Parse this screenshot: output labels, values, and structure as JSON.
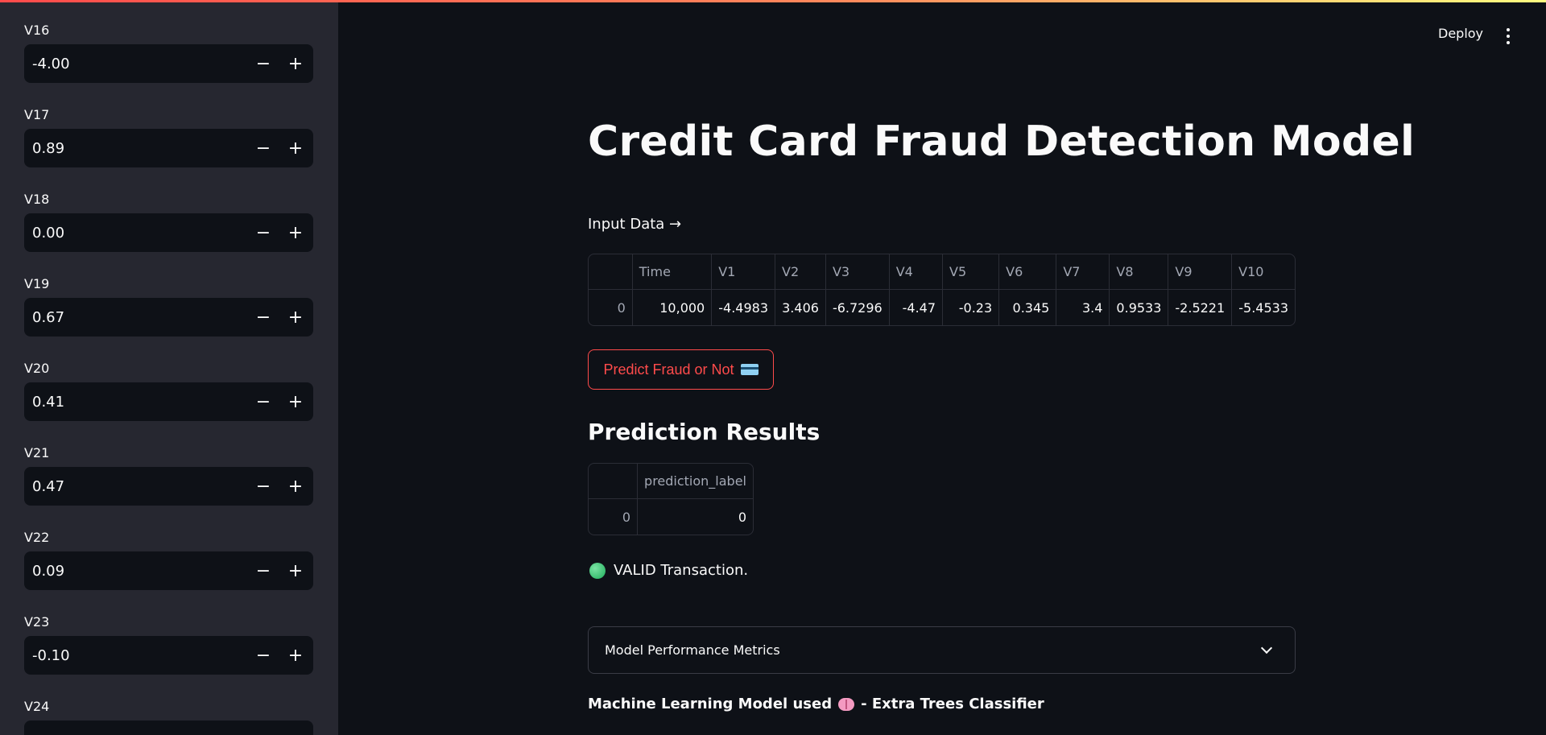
{
  "header": {
    "deploy_label": "Deploy"
  },
  "sidebar": {
    "fields": [
      {
        "label": "V16",
        "value": "-4.00"
      },
      {
        "label": "V17",
        "value": "0.89"
      },
      {
        "label": "V18",
        "value": "0.00"
      },
      {
        "label": "V19",
        "value": "0.67"
      },
      {
        "label": "V20",
        "value": "0.41"
      },
      {
        "label": "V21",
        "value": "0.47"
      },
      {
        "label": "V22",
        "value": "0.09"
      },
      {
        "label": "V23",
        "value": "-0.10"
      },
      {
        "label": "V24",
        "value": ""
      }
    ],
    "minus_symbol": "−",
    "plus_symbol": "+"
  },
  "main": {
    "title": "Credit Card Fraud Detection Model",
    "input_label": "Input Data →",
    "input_table": {
      "columns": [
        "",
        "Time",
        "V1",
        "V2",
        "V3",
        "V4",
        "V5",
        "V6",
        "V7",
        "V8",
        "V9",
        "V10"
      ],
      "rows": [
        [
          "0",
          "10,000",
          "-4.4983",
          "3.406",
          "-6.7296",
          "-4.47",
          "-0.23",
          "0.345",
          "3.4",
          "0.9533",
          "-2.5221",
          "-5.4533"
        ]
      ]
    },
    "predict_button": "Predict Fraud or Not",
    "results_title": "Prediction Results",
    "results_table": {
      "columns": [
        "",
        "prediction_label"
      ],
      "rows": [
        [
          "0",
          "0"
        ]
      ]
    },
    "valid_text": "VALID Transaction.",
    "expander_label": "Model Performance Metrics",
    "model_prefix": "Machine Learning Model used",
    "model_suffix": "- Extra Trees Classifier"
  },
  "colors": {
    "background": "#0e1117",
    "sidebar": "#262730",
    "accent": "#ff4b4b",
    "valid": "#1fae5b"
  }
}
